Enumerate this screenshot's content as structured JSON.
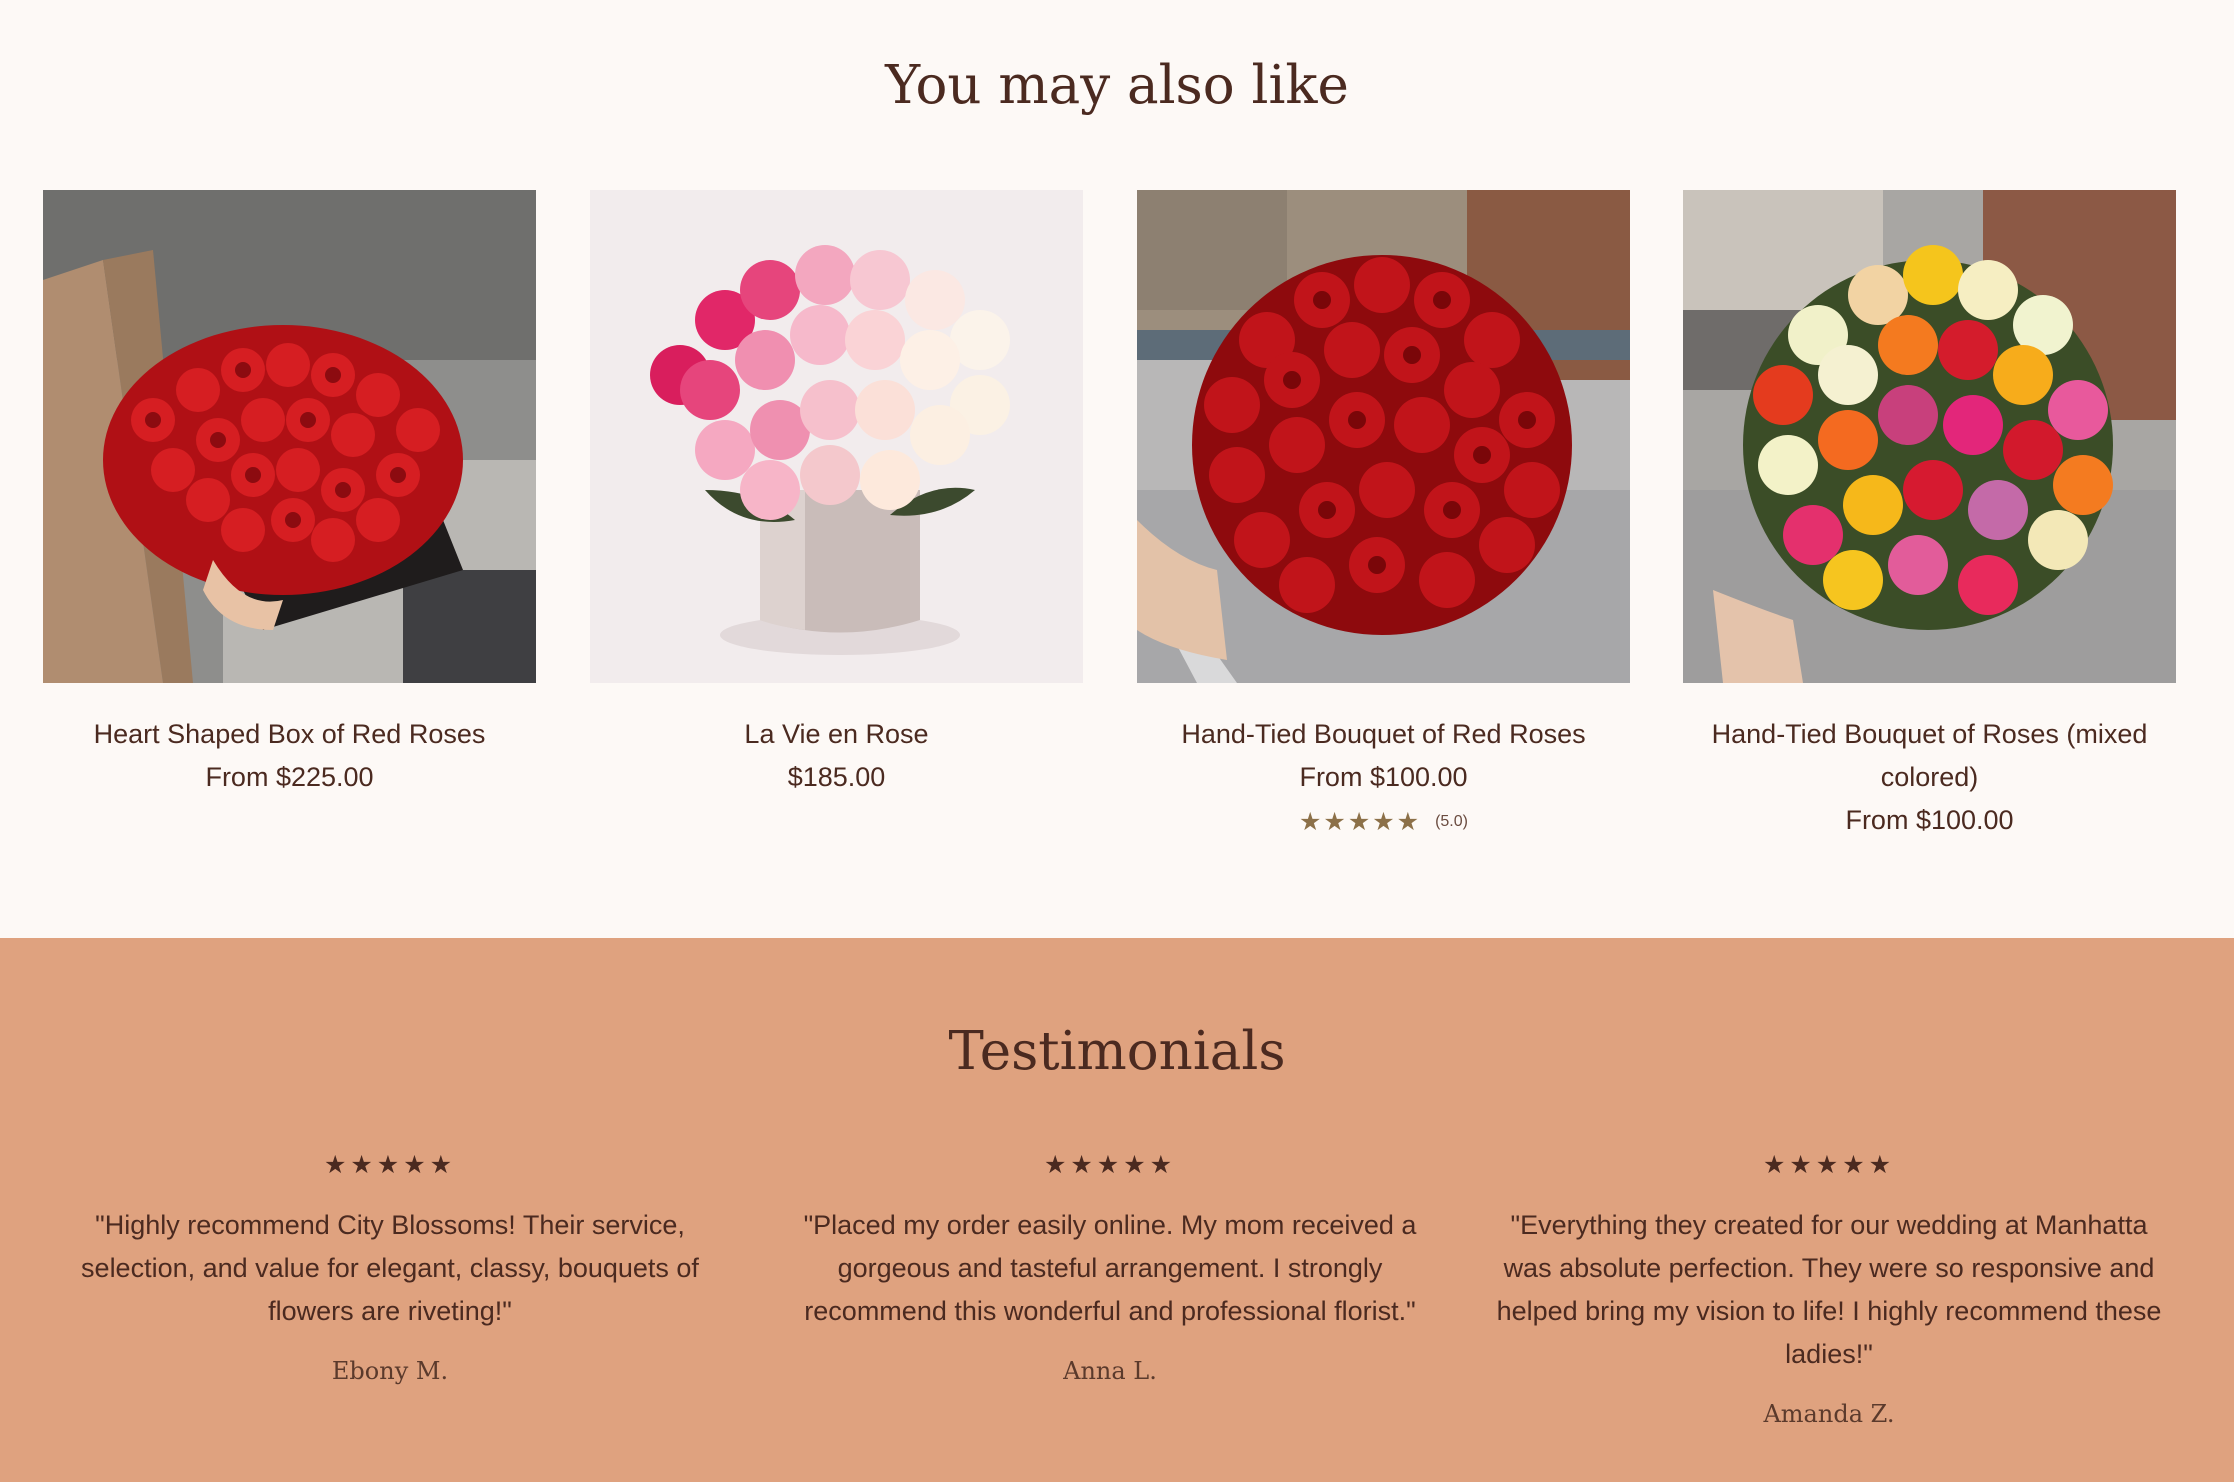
{
  "related": {
    "title": "You may also like",
    "products": [
      {
        "name": "Heart Shaped Box of Red Roses",
        "price": "From $225.00",
        "image": "heart-box-red-roses"
      },
      {
        "name": "La Vie en Rose",
        "price": "$185.00",
        "image": "pink-roses-vase"
      },
      {
        "name": "Hand-Tied Bouquet of Red Roses",
        "price": "From $100.00",
        "image": "red-roses-bouquet-street",
        "rating_stars": "★★★★★",
        "rating_count": "(5.0)",
        "rating_value": 5
      },
      {
        "name": "Hand-Tied Bouquet of Roses (mixed colored)",
        "price": "From $100.00",
        "image": "mixed-roses-bouquet-street"
      }
    ]
  },
  "testimonials": {
    "title": "Testimonials",
    "items": [
      {
        "stars": "★★★★★",
        "quote": "\"Highly recommend City Blossoms! Their service, selection, and value for elegant, classy, bouquets of flowers are riveting!\"",
        "author": "Ebony M."
      },
      {
        "stars": "★★★★★",
        "quote": "\"Placed my order easily online. My mom received a gorgeous and tasteful arrangement. I strongly recommend this wonderful and professional florist.\"",
        "author": "Anna L."
      },
      {
        "stars": "★★★★★",
        "quote": "\"Everything they created for our wedding at Manhatta was absolute perfection. They were so responsive and helped bring my vision to life! I highly recommend these ladies!\"",
        "author": "Amanda Z."
      }
    ]
  },
  "colors": {
    "page_bg": "#fdf9f6",
    "text": "#4b2a20",
    "testimonials_bg": "#dfa27f",
    "rating_star": "#8c7048"
  }
}
